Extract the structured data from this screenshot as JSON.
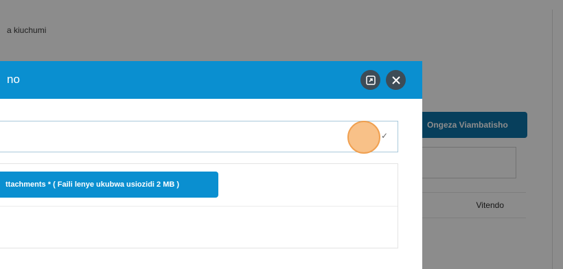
{
  "background": {
    "breadcrumb": "a kiuchumi",
    "add_attachment_button": "Ongeza Viambatisho",
    "table": {
      "column_label": "Vitendo"
    }
  },
  "modal": {
    "title": "no",
    "expand_icon": "expand-icon",
    "close_icon": "close-icon",
    "select": {
      "value": "",
      "chevron": "✓"
    },
    "upload_button": "ttachments * ( Faili lenye ukubwa usiozidi 2 MB )"
  },
  "colors": {
    "header": "#0a8fd0",
    "header_button": "#3d4c57",
    "accent_button": "#0e73a8",
    "cursor": "#f8be82"
  }
}
